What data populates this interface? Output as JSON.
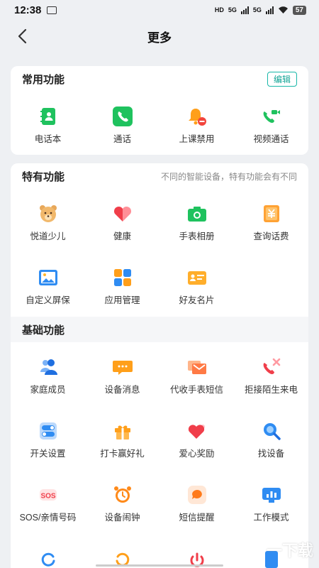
{
  "status": {
    "time": "12:38",
    "net1": "HD",
    "net2": "5G",
    "net3": "5G",
    "battery": "57"
  },
  "nav": {
    "title": "更多"
  },
  "common": {
    "title": "常用功能",
    "edit_label": "编辑",
    "items": [
      {
        "label": "电话本",
        "icon": "phonebook-icon",
        "color": "#1fc25e"
      },
      {
        "label": "通话",
        "icon": "phone-icon",
        "color": "#1fc25e"
      },
      {
        "label": "上课禁用",
        "icon": "bell-disabled-icon",
        "color": "#ff8a00"
      },
      {
        "label": "视频通话",
        "icon": "video-call-icon",
        "color": "#1fc25e"
      }
    ]
  },
  "special": {
    "title": "特有功能",
    "hint": "不同的智能设备，特有功能会有不同",
    "items": [
      {
        "label": "悦道少儿",
        "icon": "bear-icon"
      },
      {
        "label": "健康",
        "icon": "heart-icon"
      },
      {
        "label": "手表相册",
        "icon": "camera-icon"
      },
      {
        "label": "查询话费",
        "icon": "yuan-icon"
      },
      {
        "label": "自定义屏保",
        "icon": "picture-icon"
      },
      {
        "label": "应用管理",
        "icon": "apps-grid-icon"
      },
      {
        "label": "好友名片",
        "icon": "card-icon"
      }
    ]
  },
  "basic": {
    "title": "基础功能",
    "items": [
      {
        "label": "家庭成员",
        "icon": "family-icon"
      },
      {
        "label": "设备消息",
        "icon": "message-icon"
      },
      {
        "label": "代收手表短信",
        "icon": "envelope-icon"
      },
      {
        "label": "拒接陌生来电",
        "icon": "reject-call-icon"
      },
      {
        "label": "开关设置",
        "icon": "toggle-icon"
      },
      {
        "label": "打卡赢好礼",
        "icon": "gift-icon"
      },
      {
        "label": "爱心奖励",
        "icon": "love-reward-icon"
      },
      {
        "label": "找设备",
        "icon": "search-device-icon"
      },
      {
        "label": "SOS/亲情号码",
        "icon": "sos-icon"
      },
      {
        "label": "设备闹钟",
        "icon": "alarm-icon"
      },
      {
        "label": "短信提醒",
        "icon": "sms-reminder-icon"
      },
      {
        "label": "工作模式",
        "icon": "work-mode-icon"
      }
    ]
  },
  "watermark": {
    "text": "一下载"
  }
}
